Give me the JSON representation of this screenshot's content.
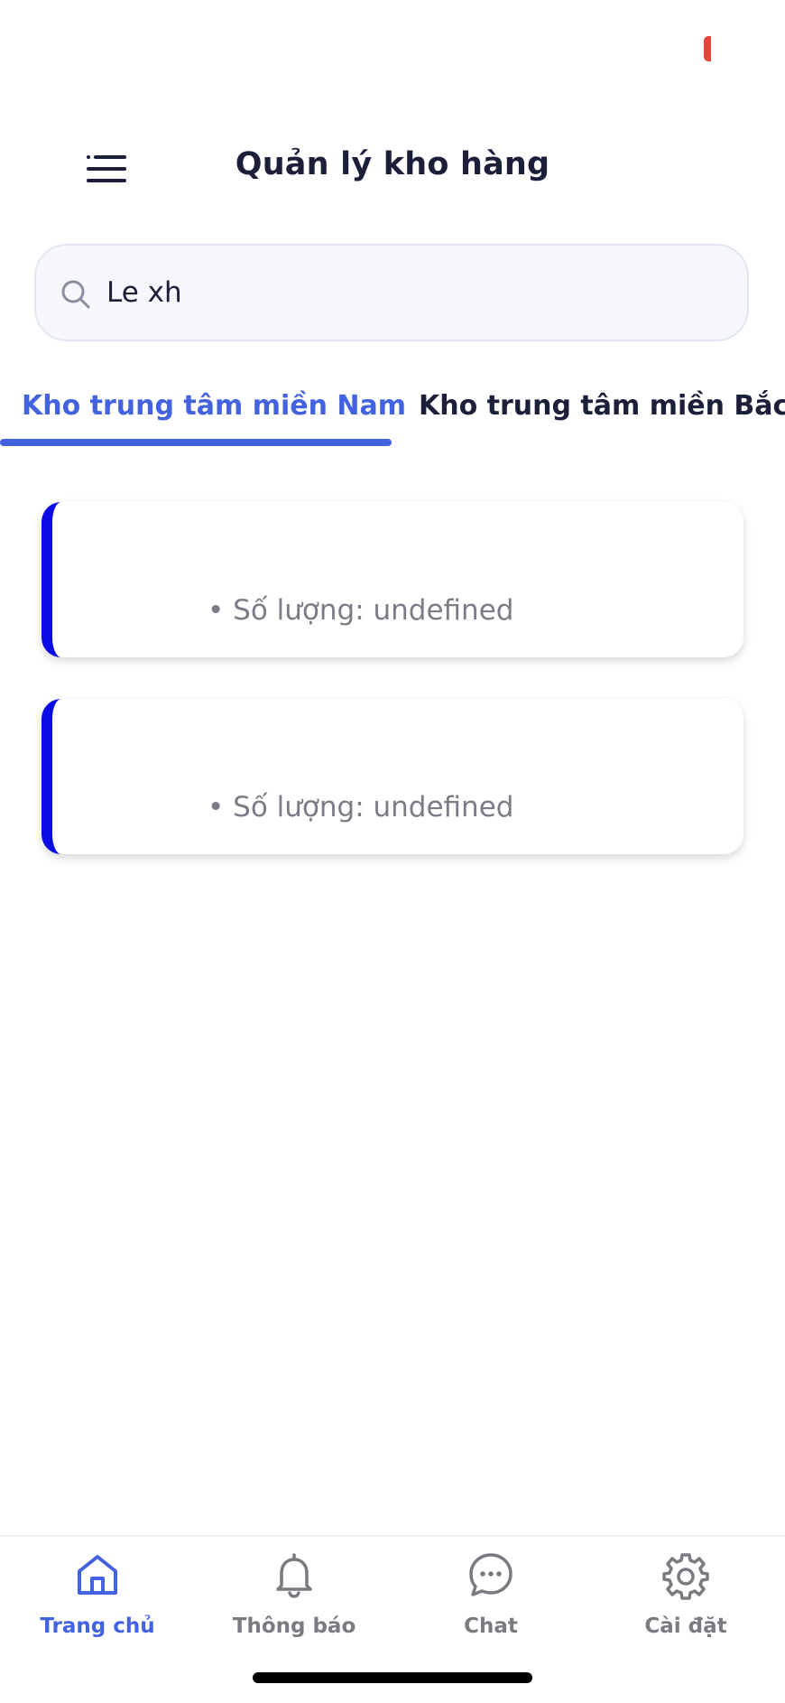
{
  "status_bar": {
    "indicator_color": "#e0463a"
  },
  "header": {
    "menu_icon": "hamburger-menu-icon",
    "title": "Quản lý kho hàng"
  },
  "search": {
    "icon": "search-icon",
    "value": "Le xh",
    "placeholder": ""
  },
  "tabs": [
    {
      "label": "Kho trung tâm miền Nam",
      "active": true
    },
    {
      "label": "Kho trung tâm miền Bắc",
      "active": false
    }
  ],
  "cards": [
    {
      "title": "",
      "quantity_text": "• Số lượng: undefined"
    },
    {
      "title": "",
      "quantity_text": "• Số lượng: undefined"
    }
  ],
  "bottom_nav": {
    "items": [
      {
        "label": "Trang chủ",
        "icon": "home-icon",
        "active": true
      },
      {
        "label": "Thông báo",
        "icon": "bell-icon",
        "active": false
      },
      {
        "label": "Chat",
        "icon": "chat-bubble-icon",
        "active": false
      },
      {
        "label": "Cài đặt",
        "icon": "gear-icon",
        "active": false
      }
    ]
  },
  "colors": {
    "accent": "#4262e0",
    "card_border": "#0a0ae6",
    "text_primary": "#1b1f3a",
    "text_muted": "#7c7c86",
    "search_bg": "#f5f7fb"
  }
}
